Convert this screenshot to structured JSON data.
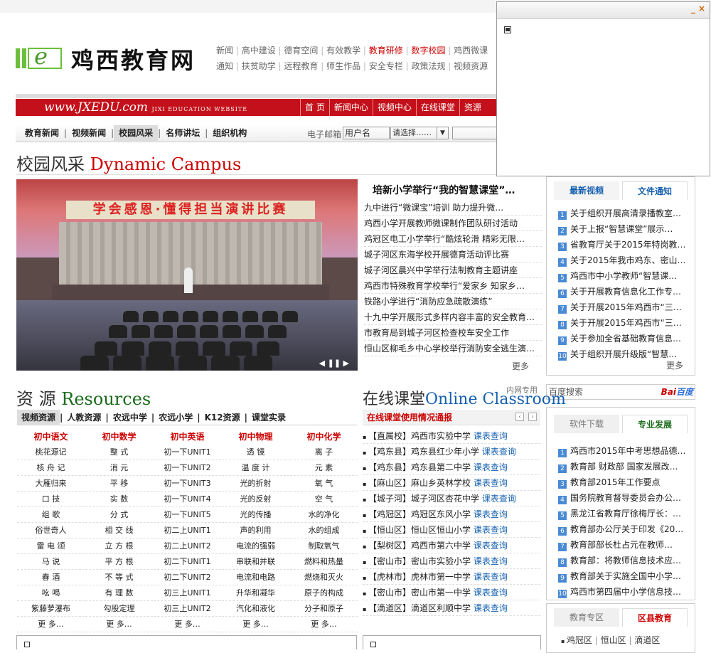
{
  "header": {
    "logo_letter": "e",
    "site_name": "鸡西教育网",
    "links_row1": [
      "新闻",
      "高中建设",
      "德育空间",
      "有效教学",
      "教育研修",
      "数字校园",
      "鸡西微课"
    ],
    "links_row1_red": [
      false,
      false,
      false,
      false,
      true,
      true,
      false
    ],
    "links_row2": [
      "通知",
      "扶贫助学",
      "远程教育",
      "师生作品",
      "安全专栏",
      "政策法规",
      "视频资源"
    ],
    "url": "www.JXEDU.com",
    "url_sub": "JIXI EDUCATION WEBSITE",
    "red_nav": [
      "首 页",
      "新闻中心",
      "视频中心",
      "在线课堂",
      "资源"
    ]
  },
  "subnav": {
    "tabs": [
      "教育新闻",
      "视频新闻",
      "校园风采",
      "名师讲坛",
      "组织机构"
    ],
    "active": 2,
    "mail_label": "电子邮箱",
    "username_placeholder": "用户名",
    "select_value": "请选择……"
  },
  "campus": {
    "title_cn": "校园风采",
    "title_en": "Dynamic Campus",
    "photo_banner": "学会感恩·懂得担当演讲比赛",
    "lead": "培新小学举行“我的智慧课堂”…",
    "items": [
      "九中进行“微课宝”培训 助力提升微…",
      "鸡西小学开展教师微课制作团队研讨活动",
      "鸡冠区电工小学举行“酷炫轮滑 精彩无限…",
      "城子河区东海学校开展德育活动评比赛",
      "城子河区晨兴中学举行法制教育主题讲座",
      "鸡西市特殊教育学校举行“爱家乡 知家乡…",
      "铁路小学进行“消防应急疏散演练”",
      "十九中学开展形式多样内容丰富的安全教育…",
      "市教育局到城子河区检查校车安全工作",
      "恒山区柳毛乡中心学校举行消防安全逃生演…"
    ],
    "more": "更多"
  },
  "right_top": {
    "tabs": [
      "最新视频",
      "文件通知"
    ],
    "items": [
      "关于组织开展高清录播教室…",
      "关于上报“智慧课堂”展示…",
      "省教育厅关于2015年特岗教…",
      "关于2015年我市鸡东、密山…",
      "鸡西市中小学教师“智慧课…",
      "关于开展教育信息化工作专…",
      "关于开展2015年鸡西市“三…",
      "关于开展2015年鸡西市“三…",
      "关于参加全省基础教育信息…",
      "关于组织开展升级版“智慧…"
    ],
    "more": "更多"
  },
  "search": {
    "placeholder": "百度搜索",
    "brand_a": "Bai",
    "brand_b": "百度"
  },
  "resources": {
    "title_cn": "资 源",
    "title_en": "Resources",
    "tabs": [
      "视频资源",
      "人教资源",
      "农远中学",
      "农远小学",
      "K12资源",
      "课堂实录"
    ],
    "columns": [
      {
        "head": "初中语文",
        "items": [
          "桃花源记",
          "核 舟 记",
          "大雁归来",
          "口  技",
          "组  歌",
          "俗世奇人",
          "雷 电 颂",
          "马  说",
          "春  酒",
          "吆  喝",
          "紫藤萝瀑布",
          "更 多…"
        ]
      },
      {
        "head": "初中数学",
        "items": [
          "整  式",
          "消  元",
          "平  移",
          "实  数",
          "分  式",
          "相 交 线",
          "立 方 根",
          "平 方 根",
          "不 等 式",
          "有 理 数",
          "勾股定理",
          "更 多…"
        ]
      },
      {
        "head": "初中英语",
        "items": [
          "初一下UNIT1",
          "初一下UNIT2",
          "初一下UNIT3",
          "初一下UNIT4",
          "初一下UNIT5",
          "初二上UNIT1",
          "初二上UNIT2",
          "初二下UNIT1",
          "初二下UNIT2",
          "初三上UNIT1",
          "初三上UNIT2",
          "更 多…"
        ]
      },
      {
        "head": "初中物理",
        "items": [
          "透  镜",
          "温 度 计",
          "光的折射",
          "光的反射",
          "光的传播",
          "声的利用",
          "电流的强弱",
          "串联和并联",
          "电流和电路",
          "升华和凝华",
          "汽化和液化",
          "更 多…"
        ]
      },
      {
        "head": "初中化学",
        "items": [
          "离  子",
          "元  素",
          "氧  气",
          "空  气",
          "水的净化",
          "水的组成",
          "制取氧气",
          "燃料和热量",
          "燃烧和灭火",
          "原子的构成",
          "分子和原子",
          "更 多…"
        ]
      }
    ]
  },
  "online": {
    "title_cn": "在线课堂",
    "title_en": "Online Classroom",
    "tag": "内网专用",
    "sub": "在线课堂使用情况通报",
    "query": "课表查询",
    "items": [
      {
        "area": "【直属校】",
        "school": "鸡西市实验中学"
      },
      {
        "area": "【鸡东县】",
        "school": "鸡东县红少年小学"
      },
      {
        "area": "【鸡东县】",
        "school": "鸡东县第二中学"
      },
      {
        "area": "【麻山区】",
        "school": "麻山乡英林学校"
      },
      {
        "area": "【城子河】",
        "school": "城子河区杏花中学"
      },
      {
        "area": "【鸡冠区】",
        "school": "鸡冠区东风小学"
      },
      {
        "area": "【恒山区】",
        "school": "恒山区恒山小学"
      },
      {
        "area": "【梨树区】",
        "school": "鸡西市第六中学"
      },
      {
        "area": "【密山市】",
        "school": "密山市实验小学"
      },
      {
        "area": "【虎林市】",
        "school": "虎林市第一中学"
      },
      {
        "area": "【密山市】",
        "school": "密山市第一中学"
      },
      {
        "area": "【滴道区】",
        "school": "滴道区利顺中学"
      }
    ]
  },
  "right_mid": {
    "tabs": [
      "软件下载",
      "专业发展"
    ],
    "items": [
      "鸡西市2015年中考思想品德…",
      "教育部 财政部 国家发展改…",
      "教育部2015年工作要点",
      "国务院教育督导委员会办公…",
      "黑龙江省教育厅徐梅厅长：…",
      "教育部办公厅关于印发《20…",
      "教育部部长杜占元在教师…",
      "教育部：将教师信息技术应…",
      "教育部关于实施全国中小学…",
      "鸡西市第四届中小学信息技…"
    ]
  },
  "right_bottom": {
    "tabs": [
      "教育专区",
      "区县教育"
    ],
    "links": [
      "鸡冠区",
      "恒山区",
      "滴道区"
    ]
  },
  "popup": {
    "min": "_",
    "close": "×"
  },
  "colors": {
    "brand_red": "#c4101a",
    "link_blue": "#1560b0",
    "accent_green": "#1a6b1a"
  }
}
